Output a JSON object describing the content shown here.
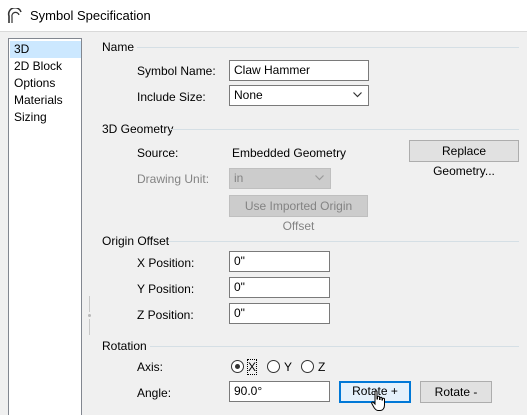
{
  "window": {
    "title": "Symbol Specification"
  },
  "sidebar": {
    "items": [
      {
        "label": "3D",
        "selected": true
      },
      {
        "label": "2D Block",
        "selected": false
      },
      {
        "label": "Options",
        "selected": false
      },
      {
        "label": "Materials",
        "selected": false
      },
      {
        "label": "Sizing",
        "selected": false
      }
    ]
  },
  "name_section": {
    "heading": "Name",
    "symbol_name_label": "Symbol Name:",
    "symbol_name_value": "Claw Hammer",
    "include_size_label": "Include Size:",
    "include_size_value": "None"
  },
  "geometry_section": {
    "heading": "3D Geometry",
    "source_label": "Source:",
    "source_value": "Embedded Geometry",
    "replace_button": "Replace Geometry...",
    "drawing_unit_label": "Drawing Unit:",
    "drawing_unit_value": "in",
    "origin_offset_button": "Use Imported Origin Offset"
  },
  "origin_section": {
    "heading": "Origin Offset",
    "x_label": "X Position:",
    "x_value": "0\"",
    "y_label": "Y Position:",
    "y_value": "0\"",
    "z_label": "Z Position:",
    "z_value": "0\""
  },
  "rotation_section": {
    "heading": "Rotation",
    "axis_label": "Axis:",
    "axis_options": [
      "X",
      "Y",
      "Z"
    ],
    "axis_selected": "X",
    "angle_label": "Angle:",
    "angle_value": "90.0°",
    "rotate_plus_button": "Rotate +",
    "rotate_minus_button": "Rotate -"
  },
  "colors": {
    "selection": "#cce8ff",
    "focus_accent": "#0078d7",
    "group_line": "#d5dfe5",
    "disabled_text": "#838383"
  }
}
